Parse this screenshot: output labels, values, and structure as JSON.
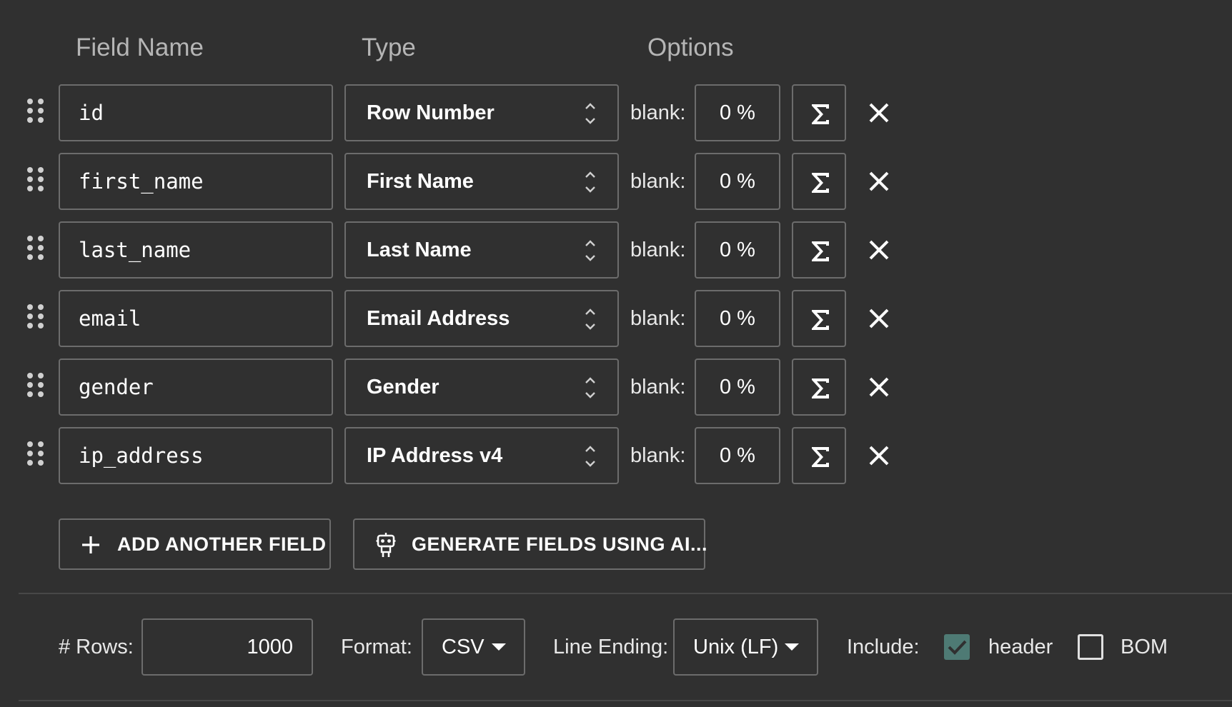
{
  "columns": {
    "field_name": "Field Name",
    "type": "Type",
    "options": "Options"
  },
  "blank_label": "blank:",
  "fields": [
    {
      "name": "id",
      "type": "Row Number",
      "blank": "0 %"
    },
    {
      "name": "first_name",
      "type": "First Name",
      "blank": "0 %"
    },
    {
      "name": "last_name",
      "type": "Last Name",
      "blank": "0 %"
    },
    {
      "name": "email",
      "type": "Email Address",
      "blank": "0 %"
    },
    {
      "name": "gender",
      "type": "Gender",
      "blank": "0 %"
    },
    {
      "name": "ip_address",
      "type": "IP Address v4",
      "blank": "0 %"
    }
  ],
  "actions": {
    "add_field": "ADD ANOTHER FIELD",
    "generate_ai": "GENERATE FIELDS USING AI..."
  },
  "options_bar": {
    "rows_label": "# Rows:",
    "rows_value": "1000",
    "format_label": "Format:",
    "format_value": "CSV",
    "line_ending_label": "Line Ending:",
    "line_ending_value": "Unix (LF)",
    "include_label": "Include:",
    "header_label": "header",
    "header_checked": true,
    "bom_label": "BOM",
    "bom_checked": false
  },
  "colors": {
    "background": "#303030",
    "border": "#6c6c6c",
    "checkbox_checked": "#4e7a74",
    "header_text": "#b5b5b5"
  },
  "icons": {
    "drag": "drag-handle-icon",
    "sigma": "sigma-icon",
    "close": "close-icon",
    "plus": "plus-icon",
    "robot": "robot-icon",
    "caret": "caret-down-icon",
    "updown": "unfold-icon",
    "check": "check-icon"
  }
}
